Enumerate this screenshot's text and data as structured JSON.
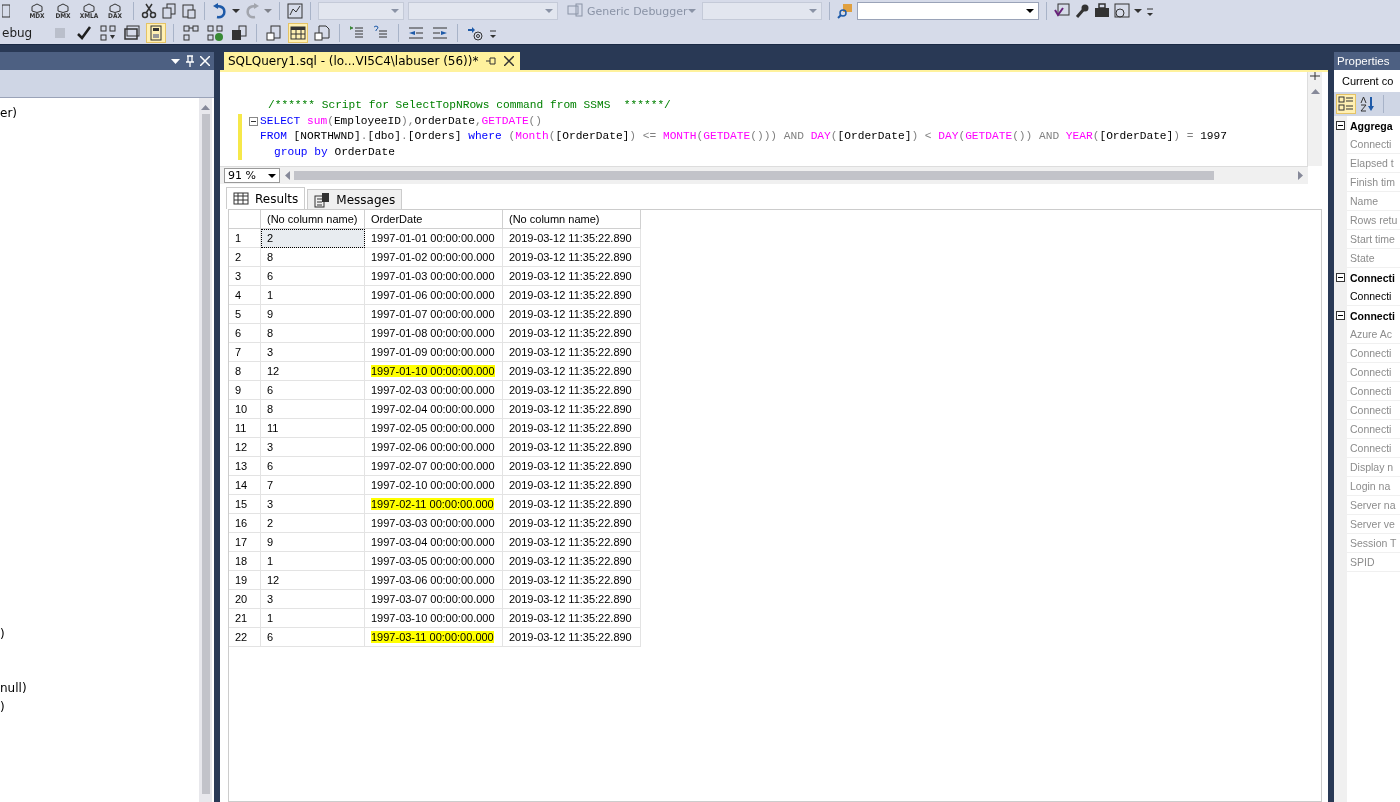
{
  "toolbar_1": {
    "query_types": [
      "MDX",
      "DMX",
      "XMLA",
      "DAX"
    ],
    "debugger": "Generic Debugger"
  },
  "toolbar_2": {
    "label": "ebug",
    "buttons": [
      {
        "on": false,
        "disabled": true
      },
      {
        "on": false,
        "disabled": false
      },
      {
        "on": false,
        "disabled": false
      },
      {
        "on": false,
        "disabled": false
      },
      {
        "on": true,
        "disabled": false
      },
      {
        "on": false,
        "disabled": false
      },
      {
        "on": false,
        "disabled": false
      },
      {
        "on": false,
        "disabled": false
      },
      {
        "on": false,
        "disabled": false
      },
      {
        "on": true,
        "disabled": false
      },
      {
        "on": false,
        "disabled": false
      },
      {
        "on": false,
        "disabled": false
      },
      {
        "on": false,
        "disabled": false
      },
      {
        "on": false,
        "disabled": false
      },
      {
        "on": false,
        "disabled": false
      },
      {
        "on": false,
        "disabled": false
      }
    ]
  },
  "object_explorer": {
    "lines": [
      "er)",
      ")",
      "null)",
      ")"
    ]
  },
  "editor": {
    "tab": {
      "title": "SQLQuery1.sql - (lo...VI5C4\\labuser (56))*",
      "selected": true
    },
    "code": [
      [
        {
          "kind": "comment",
          "text": "/****** Script for SelectTopNRows command from SSMS  ******/"
        }
      ],
      [
        {
          "kind": "keyword",
          "text": "SELECT "
        },
        {
          "kind": "function",
          "text": "sum"
        },
        {
          "kind": "operator",
          "text": "("
        },
        {
          "kind": "text",
          "text": "EmployeeID"
        },
        {
          "kind": "operator",
          "text": "),"
        },
        {
          "kind": "text",
          "text": "OrderDate"
        },
        {
          "kind": "operator",
          "text": ","
        },
        {
          "kind": "function",
          "text": "GETDATE"
        },
        {
          "kind": "operator",
          "text": "()"
        }
      ],
      [
        {
          "kind": "keyword",
          "text": "FROM "
        },
        {
          "kind": "text",
          "text": "[NORTHWND]"
        },
        {
          "kind": "operator",
          "text": "."
        },
        {
          "kind": "text",
          "text": "[dbo]"
        },
        {
          "kind": "operator",
          "text": "."
        },
        {
          "kind": "text",
          "text": "[Orders] "
        },
        {
          "kind": "keyword",
          "text": "where "
        },
        {
          "kind": "operator",
          "text": "("
        },
        {
          "kind": "function",
          "text": "Month"
        },
        {
          "kind": "operator",
          "text": "("
        },
        {
          "kind": "text",
          "text": "[OrderDate]"
        },
        {
          "kind": "operator",
          "text": ") <= "
        },
        {
          "kind": "function",
          "text": "MONTH"
        },
        {
          "kind": "operator",
          "text": "("
        },
        {
          "kind": "function",
          "text": "GETDATE"
        },
        {
          "kind": "operator",
          "text": "())) AND "
        },
        {
          "kind": "function",
          "text": "DAY"
        },
        {
          "kind": "operator",
          "text": "("
        },
        {
          "kind": "text",
          "text": "[OrderDate]"
        },
        {
          "kind": "operator",
          "text": ") < "
        },
        {
          "kind": "function",
          "text": "DAY"
        },
        {
          "kind": "operator",
          "text": "("
        },
        {
          "kind": "function",
          "text": "GETDATE"
        },
        {
          "kind": "operator",
          "text": "()) AND "
        },
        {
          "kind": "function",
          "text": "YEAR"
        },
        {
          "kind": "operator",
          "text": "("
        },
        {
          "kind": "text",
          "text": "[OrderDate]"
        },
        {
          "kind": "operator",
          "text": ") = "
        },
        {
          "kind": "text",
          "text": "1997"
        }
      ],
      [
        {
          "kind": "keyword",
          "text": "group by "
        },
        {
          "kind": "text",
          "text": "OrderDate"
        }
      ]
    ],
    "zoom": "91 %"
  },
  "results": {
    "tabs": [
      {
        "label": "Results",
        "selected": true
      },
      {
        "label": "Messages",
        "selected": false
      }
    ],
    "columns": [
      "(No column name)",
      "OrderDate",
      "(No column name)"
    ],
    "rows": [
      {
        "num": "1",
        "cells": [
          "2",
          "1997-01-01 00:00:00.000",
          "2019-03-12 11:35:22.890"
        ],
        "focused": true,
        "highlighted": false
      },
      {
        "num": "2",
        "cells": [
          "8",
          "1997-01-02 00:00:00.000",
          "2019-03-12 11:35:22.890"
        ],
        "focused": false,
        "highlighted": false
      },
      {
        "num": "3",
        "cells": [
          "6",
          "1997-01-03 00:00:00.000",
          "2019-03-12 11:35:22.890"
        ],
        "focused": false,
        "highlighted": false
      },
      {
        "num": "4",
        "cells": [
          "1",
          "1997-01-06 00:00:00.000",
          "2019-03-12 11:35:22.890"
        ],
        "focused": false,
        "highlighted": false
      },
      {
        "num": "5",
        "cells": [
          "9",
          "1997-01-07 00:00:00.000",
          "2019-03-12 11:35:22.890"
        ],
        "focused": false,
        "highlighted": false
      },
      {
        "num": "6",
        "cells": [
          "8",
          "1997-01-08 00:00:00.000",
          "2019-03-12 11:35:22.890"
        ],
        "focused": false,
        "highlighted": false
      },
      {
        "num": "7",
        "cells": [
          "3",
          "1997-01-09 00:00:00.000",
          "2019-03-12 11:35:22.890"
        ],
        "focused": false,
        "highlighted": false
      },
      {
        "num": "8",
        "cells": [
          "12",
          "1997-01-10 00:00:00.000",
          "2019-03-12 11:35:22.890"
        ],
        "focused": false,
        "highlighted": true
      },
      {
        "num": "9",
        "cells": [
          "6",
          "1997-02-03 00:00:00.000",
          "2019-03-12 11:35:22.890"
        ],
        "focused": false,
        "highlighted": false
      },
      {
        "num": "10",
        "cells": [
          "8",
          "1997-02-04 00:00:00.000",
          "2019-03-12 11:35:22.890"
        ],
        "focused": false,
        "highlighted": false
      },
      {
        "num": "11",
        "cells": [
          "11",
          "1997-02-05 00:00:00.000",
          "2019-03-12 11:35:22.890"
        ],
        "focused": false,
        "highlighted": false
      },
      {
        "num": "12",
        "cells": [
          "3",
          "1997-02-06 00:00:00.000",
          "2019-03-12 11:35:22.890"
        ],
        "focused": false,
        "highlighted": false
      },
      {
        "num": "13",
        "cells": [
          "6",
          "1997-02-07 00:00:00.000",
          "2019-03-12 11:35:22.890"
        ],
        "focused": false,
        "highlighted": false
      },
      {
        "num": "14",
        "cells": [
          "7",
          "1997-02-10 00:00:00.000",
          "2019-03-12 11:35:22.890"
        ],
        "focused": false,
        "highlighted": false
      },
      {
        "num": "15",
        "cells": [
          "3",
          "1997-02-11 00:00:00.000",
          "2019-03-12 11:35:22.890"
        ],
        "focused": false,
        "highlighted": true
      },
      {
        "num": "16",
        "cells": [
          "2",
          "1997-03-03 00:00:00.000",
          "2019-03-12 11:35:22.890"
        ],
        "focused": false,
        "highlighted": false
      },
      {
        "num": "17",
        "cells": [
          "9",
          "1997-03-04 00:00:00.000",
          "2019-03-12 11:35:22.890"
        ],
        "focused": false,
        "highlighted": false
      },
      {
        "num": "18",
        "cells": [
          "1",
          "1997-03-05 00:00:00.000",
          "2019-03-12 11:35:22.890"
        ],
        "focused": false,
        "highlighted": false
      },
      {
        "num": "19",
        "cells": [
          "12",
          "1997-03-06 00:00:00.000",
          "2019-03-12 11:35:22.890"
        ],
        "focused": false,
        "highlighted": false
      },
      {
        "num": "20",
        "cells": [
          "3",
          "1997-03-07 00:00:00.000",
          "2019-03-12 11:35:22.890"
        ],
        "focused": false,
        "highlighted": false
      },
      {
        "num": "21",
        "cells": [
          "1",
          "1997-03-10 00:00:00.000",
          "2019-03-12 11:35:22.890"
        ],
        "focused": false,
        "highlighted": false
      },
      {
        "num": "22",
        "cells": [
          "6",
          "1997-03-11 00:00:00.000",
          "2019-03-12 11:35:22.890"
        ],
        "focused": false,
        "highlighted": true
      }
    ]
  },
  "properties": {
    "title": "Properties",
    "object": "Current co",
    "categories": [
      {
        "label": "Aggrega",
        "expanded": true,
        "items": [
          {
            "label": "Connecti",
            "disabled": true
          },
          {
            "label": "Elapsed t",
            "disabled": true
          },
          {
            "label": "Finish tim",
            "disabled": true
          },
          {
            "label": "Name",
            "disabled": true
          },
          {
            "label": "Rows retu",
            "disabled": true
          },
          {
            "label": "Start time",
            "disabled": true
          },
          {
            "label": "State",
            "disabled": true
          }
        ]
      },
      {
        "label": "Connecti",
        "expanded": true,
        "items": [
          {
            "label": "Connecti",
            "disabled": false
          }
        ]
      },
      {
        "label": "Connecti",
        "expanded": true,
        "items": [
          {
            "label": "Azure Ac",
            "disabled": true
          },
          {
            "label": "Connecti",
            "disabled": true
          },
          {
            "label": "Connecti",
            "disabled": true
          },
          {
            "label": "Connecti",
            "disabled": true
          },
          {
            "label": "Connecti",
            "disabled": true
          },
          {
            "label": "Connecti",
            "disabled": true
          },
          {
            "label": "Connecti",
            "disabled": true
          },
          {
            "label": "Display n",
            "disabled": true
          },
          {
            "label": "Login na",
            "disabled": true
          },
          {
            "label": "Server na",
            "disabled": true
          },
          {
            "label": "Server ve",
            "disabled": true
          },
          {
            "label": "Session T",
            "disabled": true
          },
          {
            "label": "SPID",
            "disabled": true
          }
        ]
      }
    ]
  }
}
